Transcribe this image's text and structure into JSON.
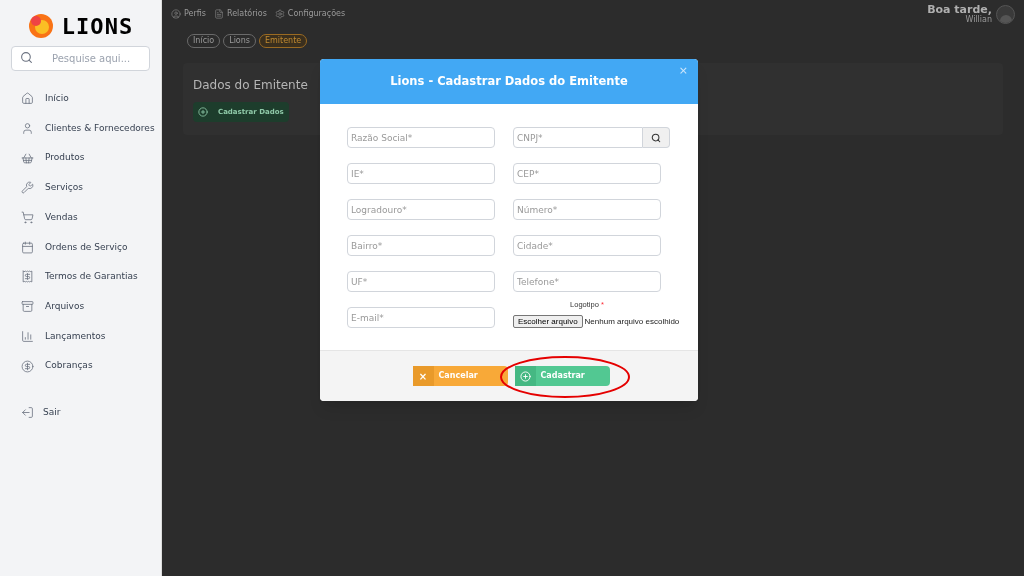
{
  "sidebar": {
    "brand": "LIONS",
    "search": {
      "placeholder": "Pesquise aqui..."
    },
    "items": [
      {
        "label": "Início"
      },
      {
        "label": "Clientes & Fornecedores"
      },
      {
        "label": "Produtos"
      },
      {
        "label": "Serviços"
      },
      {
        "label": "Vendas"
      },
      {
        "label": "Ordens de Serviço"
      },
      {
        "label": "Termos de Garantias"
      },
      {
        "label": "Arquivos"
      },
      {
        "label": "Lançamentos"
      },
      {
        "label": "Cobranças"
      }
    ],
    "logout": {
      "label": "Sair"
    }
  },
  "topbar": {
    "links": [
      {
        "label": "Perfis"
      },
      {
        "label": "Relatórios"
      },
      {
        "label": "Configurações"
      }
    ],
    "greeting": "Boa tarde,",
    "user": "Willian"
  },
  "breadcrumbs": [
    {
      "label": "Início",
      "selected": false
    },
    {
      "label": "Lions",
      "selected": false
    },
    {
      "label": "Emitente",
      "selected": true
    }
  ],
  "page": {
    "title": "Dados do Emitente",
    "button": "Cadastrar Dados"
  },
  "modal": {
    "title": "Lions - Cadastrar Dados do Emitente",
    "close": "×",
    "rows": [
      [
        {
          "kind": "text",
          "placeholder": "Razão Social*"
        },
        {
          "kind": "search",
          "placeholder": "CNPJ*"
        }
      ],
      [
        {
          "kind": "text",
          "placeholder": "IE*"
        },
        {
          "kind": "text",
          "placeholder": "CEP*"
        }
      ],
      [
        {
          "kind": "text",
          "placeholder": "Logradouro*"
        },
        {
          "kind": "text",
          "placeholder": "Número*"
        }
      ],
      [
        {
          "kind": "text",
          "placeholder": "Bairro*"
        },
        {
          "kind": "text",
          "placeholder": "Cidade*"
        }
      ],
      [
        {
          "kind": "text",
          "placeholder": "UF*"
        },
        {
          "kind": "text",
          "placeholder": "Telefone*"
        }
      ],
      [
        {
          "kind": "text",
          "placeholder": "E-mail*"
        },
        {
          "kind": "file",
          "label": "Logotipo",
          "required": "*",
          "button": "Escolher arquivo",
          "status": "Nenhum arquivo escolhido"
        }
      ]
    ],
    "buttons": [
      {
        "kind": "cancel",
        "label": "Cancelar",
        "icon": "×"
      },
      {
        "kind": "submit",
        "label": "Cadastrar",
        "highlighted": true
      }
    ]
  }
}
